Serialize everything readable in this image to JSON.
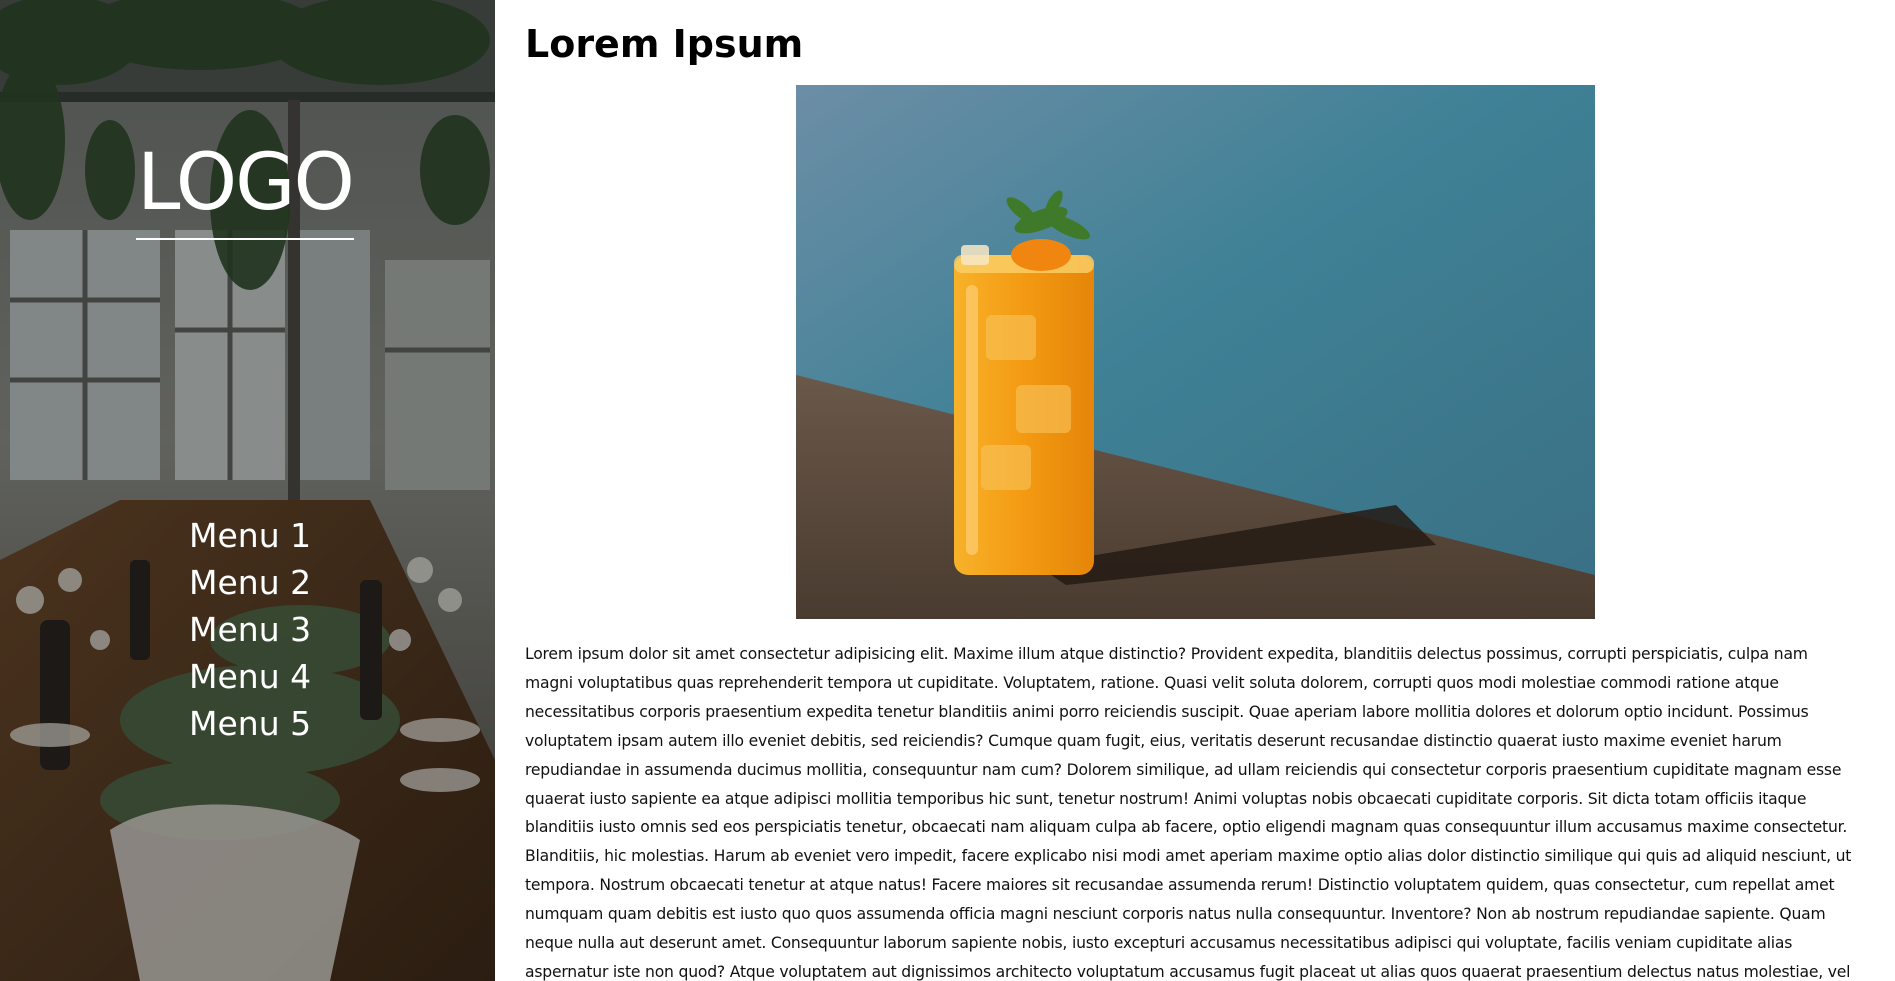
{
  "sidebar": {
    "logo": "LOGO",
    "menu": [
      "Menu 1",
      "Menu 2",
      "Menu 3",
      "Menu 4",
      "Menu 5"
    ]
  },
  "main": {
    "title": "Lorem Ipsum",
    "body": "Lorem ipsum dolor sit amet consectetur adipisicing elit. Maxime illum atque distinctio? Provident expedita, blanditiis delectus possimus, corrupti perspiciatis, culpa nam magni voluptatibus quas reprehenderit tempora ut cupiditate. Voluptatem, ratione. Quasi velit soluta dolorem, corrupti quos modi molestiae commodi ratione atque necessitatibus corporis praesentium expedita tenetur blanditiis animi porro reiciendis suscipit. Quae aperiam labore mollitia dolores et dolorum optio incidunt. Possimus voluptatem ipsam autem illo eveniet debitis, sed reiciendis? Cumque quam fugit, eius, veritatis deserunt recusandae distinctio quaerat iusto maxime eveniet harum repudiandae in assumenda ducimus mollitia, consequuntur nam cum? Dolorem similique, ad ullam reiciendis qui consectetur corporis praesentium cupiditate magnam esse quaerat iusto sapiente ea atque adipisci mollitia temporibus hic sunt, tenetur nostrum! Animi voluptas nobis obcaecati cupiditate corporis. Sit dicta totam officiis itaque blanditiis iusto omnis sed eos perspiciatis tenetur, obcaecati nam aliquam culpa ab facere, optio eligendi magnam quas consequuntur illum accusamus maxime consectetur. Blanditiis, hic molestias. Harum ab eveniet vero impedit, facere explicabo nisi modi amet aperiam maxime optio alias dolor distinctio similique qui quis ad aliquid nesciunt, ut tempora. Nostrum obcaecati tenetur at atque natus! Facere maiores sit recusandae assumenda rerum! Distinctio voluptatem quidem, quas consectetur, cum repellat amet numquam quam debitis est iusto quo quos assumenda officia magni nesciunt corporis natus nulla consequuntur. Inventore? Non ab nostrum repudiandae sapiente. Quam neque nulla aut deserunt amet. Consequuntur laborum sapiente nobis, iusto excepturi accusamus necessitatibus adipisci qui voluptate, facilis veniam cupiditate alias aspernatur iste non quod? Atque voluptatem aut dignissimos architecto voluptatum accusamus fugit placeat ut alias quos quaerat praesentium delectus natus molestiae, vel vitae, magnam facere quam repudiandae sed. Eius dolores in maiores illo beatae! Possimus magnam corrupti"
  },
  "colors": {
    "sidebar_text": "#ffffff",
    "title_text": "#000000",
    "body_text": "#111111",
    "sea": "#3f8196",
    "juice": "#f39a12"
  }
}
